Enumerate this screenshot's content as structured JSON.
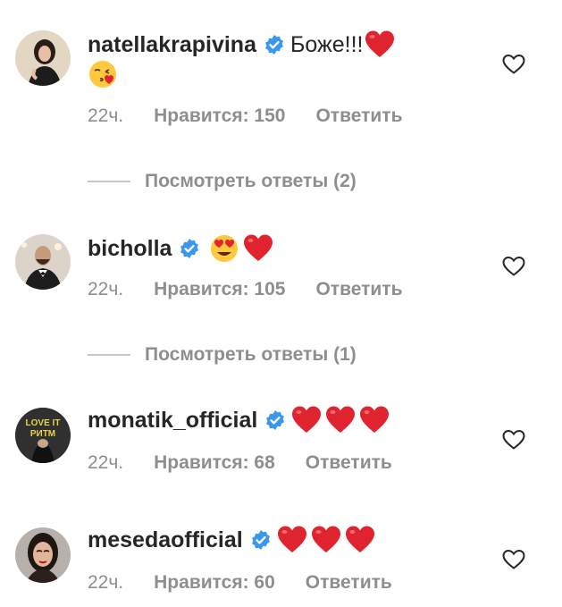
{
  "comments": [
    {
      "username": "natellakrapivina",
      "text": "Боже!!!",
      "emojis_inline": [
        "red-heart"
      ],
      "emojis_second_line": [
        "face-blowing-kiss"
      ],
      "time": "22ч.",
      "likes": "Нравится: 150",
      "reply": "Ответить",
      "view_replies": "Посмотреть ответы (2)"
    },
    {
      "username": "bicholla",
      "text": "",
      "emojis_inline": [
        "heart-eyes",
        "red-heart"
      ],
      "time": "22ч.",
      "likes": "Нравится: 105",
      "reply": "Ответить",
      "view_replies": "Посмотреть ответы (1)"
    },
    {
      "username": "monatik_official",
      "text": "",
      "emojis_inline": [
        "red-heart",
        "red-heart",
        "red-heart"
      ],
      "avatar_text": "LOVE IT РИТМ",
      "time": "22ч.",
      "likes": "Нравится: 68",
      "reply": "Ответить"
    },
    {
      "username": "mesedaofficial",
      "text": "",
      "emojis_inline": [
        "red-heart",
        "red-heart",
        "red-heart"
      ],
      "time": "22ч.",
      "likes": "Нравится: 60",
      "reply": "Ответить"
    }
  ],
  "colors": {
    "text": "#262626",
    "secondary": "#8e8e8e",
    "verified": "#3897f0",
    "heart": "#e0242f"
  }
}
